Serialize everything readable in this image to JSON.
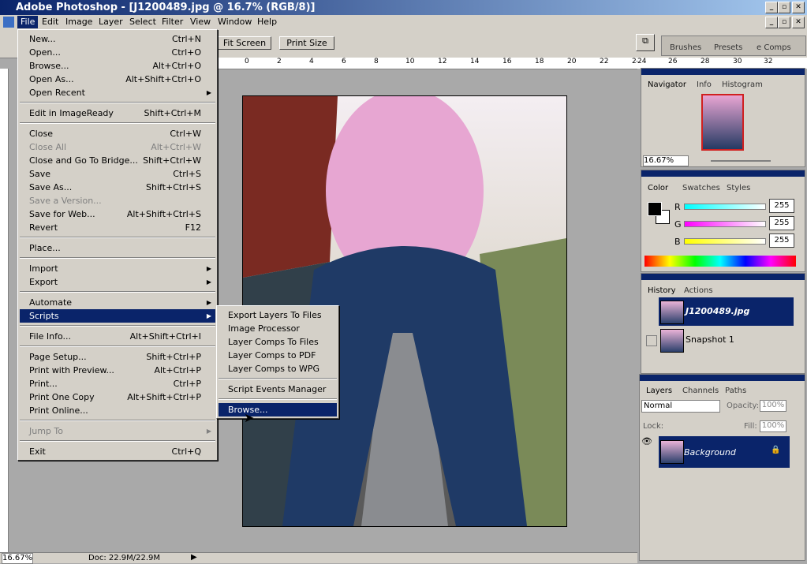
{
  "app": {
    "title": "Adobe Photoshop - [J1200489.jpg @ 16.7% (RGB/8)]"
  },
  "menubar": {
    "items": [
      "File",
      "Edit",
      "Image",
      "Layer",
      "Select",
      "Filter",
      "View",
      "Window",
      "Help"
    ]
  },
  "options": {
    "fit_screen": "Fit Screen",
    "print_size": "Print Size"
  },
  "palette_well": {
    "tabs": [
      "Brushes",
      "Presets",
      "e Comps"
    ]
  },
  "ruler": {
    "labels": [
      "0",
      "2",
      "4",
      "6",
      "8",
      "10",
      "12",
      "14",
      "16",
      "18",
      "20",
      "22",
      "24",
      "26",
      "28",
      "30",
      "32"
    ]
  },
  "file_menu": {
    "items": [
      {
        "label": "New...",
        "shortcut": "Ctrl+N"
      },
      {
        "label": "Open...",
        "shortcut": "Ctrl+O"
      },
      {
        "label": "Browse...",
        "shortcut": "Alt+Ctrl+O"
      },
      {
        "label": "Open As...",
        "shortcut": "Alt+Shift+Ctrl+O"
      },
      {
        "label": "Open Recent",
        "shortcut": ""
      },
      {
        "label": "Edit in ImageReady",
        "shortcut": "Shift+Ctrl+M"
      },
      {
        "label": "Close",
        "shortcut": "Ctrl+W"
      },
      {
        "label": "Close All",
        "shortcut": "Alt+Ctrl+W"
      },
      {
        "label": "Close and Go To Bridge...",
        "shortcut": "Shift+Ctrl+W"
      },
      {
        "label": "Save",
        "shortcut": "Ctrl+S"
      },
      {
        "label": "Save As...",
        "shortcut": "Shift+Ctrl+S"
      },
      {
        "label": "Save a Version...",
        "shortcut": ""
      },
      {
        "label": "Save for Web...",
        "shortcut": "Alt+Shift+Ctrl+S"
      },
      {
        "label": "Revert",
        "shortcut": "F12"
      },
      {
        "label": "Place...",
        "shortcut": ""
      },
      {
        "label": "Import",
        "shortcut": ""
      },
      {
        "label": "Export",
        "shortcut": ""
      },
      {
        "label": "Automate",
        "shortcut": ""
      },
      {
        "label": "Scripts",
        "shortcut": ""
      },
      {
        "label": "File Info...",
        "shortcut": "Alt+Shift+Ctrl+I"
      },
      {
        "label": "Page Setup...",
        "shortcut": "Shift+Ctrl+P"
      },
      {
        "label": "Print with Preview...",
        "shortcut": "Alt+Ctrl+P"
      },
      {
        "label": "Print...",
        "shortcut": "Ctrl+P"
      },
      {
        "label": "Print One Copy",
        "shortcut": "Alt+Shift+Ctrl+P"
      },
      {
        "label": "Print Online...",
        "shortcut": ""
      },
      {
        "label": "Jump To",
        "shortcut": ""
      },
      {
        "label": "Exit",
        "shortcut": "Ctrl+Q"
      }
    ]
  },
  "scripts_menu": {
    "items": [
      "Export Layers To Files",
      "Image Processor",
      "Layer Comps To Files",
      "Layer Comps to PDF",
      "Layer Comps to WPG",
      "Script Events Manager",
      "Browse..."
    ]
  },
  "navigator": {
    "tabs": [
      "Navigator",
      "Info",
      "Histogram"
    ],
    "zoom": "16.67%"
  },
  "color": {
    "tabs": [
      "Color",
      "Swatches",
      "Styles"
    ],
    "r_label": "R",
    "g_label": "G",
    "b_label": "B",
    "r": "255",
    "g": "255",
    "b": "255",
    "r_fill": 1,
    "g_fill": 1,
    "b_fill": 1
  },
  "history": {
    "tabs": [
      "History",
      "Actions"
    ],
    "items": [
      "J1200489.jpg",
      "Snapshot 1"
    ]
  },
  "layers": {
    "tabs": [
      "Layers",
      "Channels",
      "Paths"
    ],
    "blend_mode": "Normal",
    "opacity_label": "Opacity:",
    "opacity": "100%",
    "lock_label": "Lock:",
    "fill_label": "Fill:",
    "fill": "100%",
    "layer_name": "Background"
  },
  "status": {
    "zoom": "16.67%",
    "doc": "Doc: 22.9M/22.9M"
  }
}
